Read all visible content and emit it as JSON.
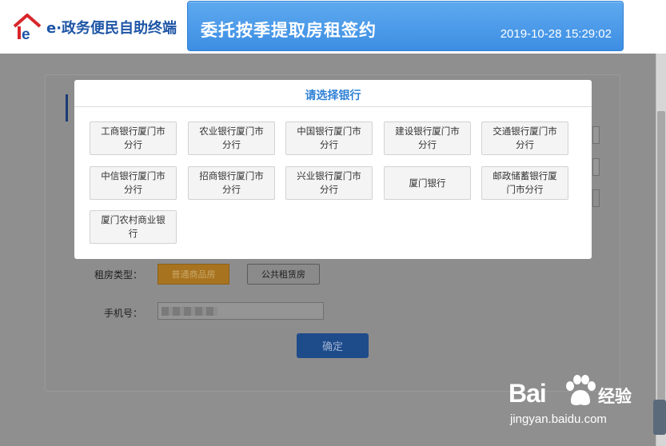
{
  "header": {
    "logo_text": "e·政务便民自助终端",
    "title": "委托按季提取房租签约",
    "datetime": "2019-10-28 15:29:02"
  },
  "form": {
    "rent_type_label": "租房类型：",
    "rent_type_options": [
      "普通商品房",
      "公共租赁房"
    ],
    "phone_label": "手机号：",
    "confirm_label": "确定"
  },
  "modal": {
    "title": "请选择银行",
    "banks": [
      "工商银行厦门市分行",
      "农业银行厦门市分行",
      "中国银行厦门市分行",
      "建设银行厦门市分行",
      "交通银行厦门市分行",
      "中信银行厦门市分行",
      "招商银行厦门市分行",
      "兴业银行厦门市分行",
      "厦门银行",
      "邮政储蓄银行厦门市分行",
      "厦门农村商业银行"
    ]
  },
  "watermark": {
    "brand": "Bai",
    "cn": "经验",
    "url": "jingyan.baidu.com"
  },
  "colors": {
    "accent_blue": "#2f80d6",
    "selected_orange": "#a8731f",
    "overlay": "#8f8f8f"
  }
}
